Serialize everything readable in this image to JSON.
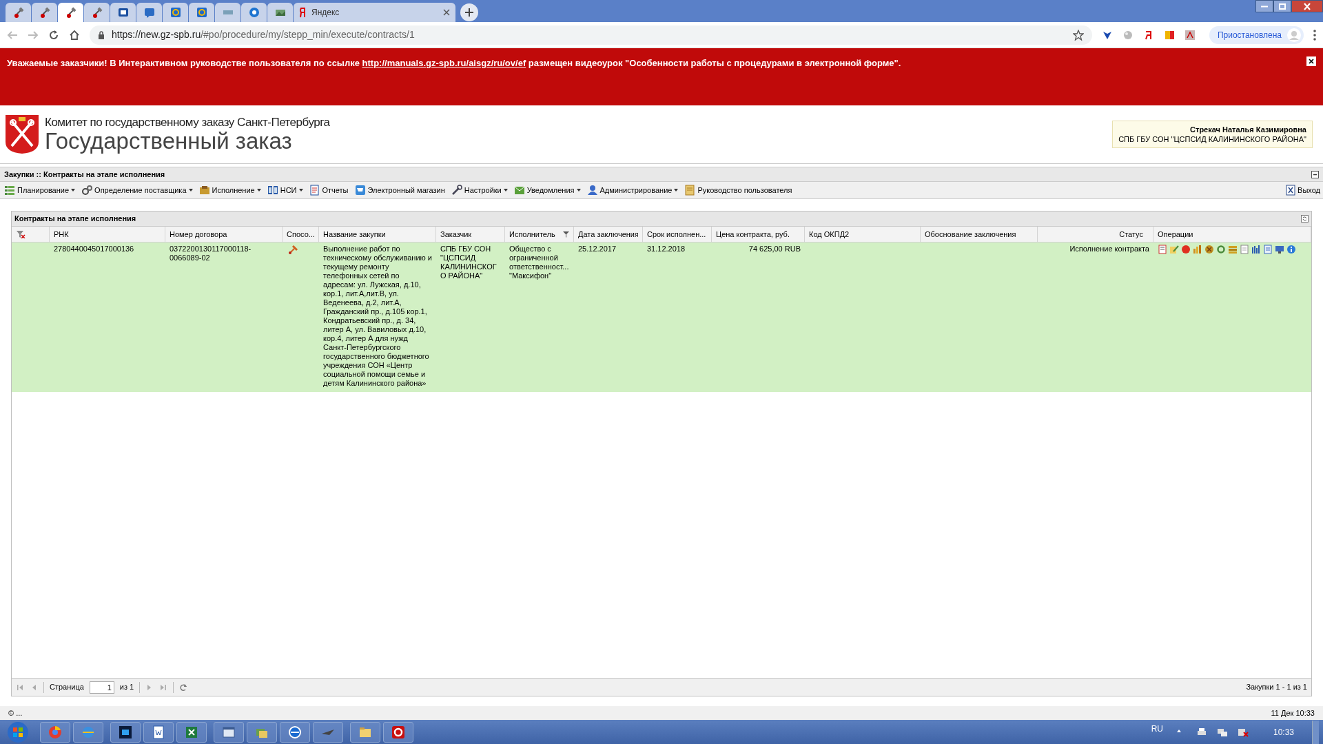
{
  "browser": {
    "tabs": [
      {
        "selected": false
      },
      {
        "selected": false
      },
      {
        "selected": true
      },
      {
        "selected": false
      },
      {
        "selected": false
      },
      {
        "selected": false
      },
      {
        "selected": false
      },
      {
        "selected": false
      },
      {
        "selected": false
      },
      {
        "selected": false
      },
      {
        "selected": false
      },
      {
        "selected": false,
        "label": "Яндекс"
      }
    ],
    "url_host": "https://new.gz-spb.ru",
    "url_path": "/#po/procedure/my/stepp_min/execute/contracts/1",
    "profile": "Приостановлена"
  },
  "banner": {
    "text_before": "Уважаемые заказчики! В Интерактивном руководстве пользователя по ссылке",
    "link": "http://manuals.gz-spb.ru/aisgz/ru/ov/ef",
    "text_after": "размещен видеоурок \"Особенности работы с процедурами в электронной форме\"."
  },
  "header": {
    "org": "Комитет по государственному заказу Санкт-Петербурга",
    "title": "Государственный заказ",
    "user_name": "Стрекач Наталья Казимировна",
    "user_org": "СПБ ГБУ СОН \"ЦСПСИД КАЛИНИНСКОГО РАЙОНА\""
  },
  "breadcrumb": "Закупки :: Контракты на этапе исполнения",
  "menu": [
    {
      "label": "Планирование",
      "dropdown": true
    },
    {
      "label": "Определение поставщика",
      "dropdown": true
    },
    {
      "label": "Исполнение",
      "dropdown": true
    },
    {
      "label": "НСИ",
      "dropdown": true
    },
    {
      "label": "Отчеты",
      "dropdown": false
    },
    {
      "label": "Электронный магазин",
      "dropdown": false
    },
    {
      "label": "Настройки",
      "dropdown": true
    },
    {
      "label": "Уведомления",
      "dropdown": true
    },
    {
      "label": "Администрирование",
      "dropdown": true
    },
    {
      "label": "Руководство пользователя",
      "dropdown": false
    }
  ],
  "exit": "Выход",
  "panel": {
    "title": "Контракты на этапе исполнения",
    "columns": [
      {
        "label": "РНК",
        "filtered": false
      },
      {
        "label": "Номер договора",
        "filtered": false
      },
      {
        "label": "Спосо...",
        "filtered": false
      },
      {
        "label": "Название закупки",
        "filtered": false
      },
      {
        "label": "Заказчик",
        "filtered": false
      },
      {
        "label": "Исполнитель",
        "filtered": true
      },
      {
        "label": "Дата заключения",
        "filtered": false
      },
      {
        "label": "Срок исполнен...",
        "filtered": false
      },
      {
        "label": "Цена контракта, руб.",
        "filtered": false
      },
      {
        "label": "Код ОКПД2",
        "filtered": false
      },
      {
        "label": "Обоснование заключения",
        "filtered": false
      },
      {
        "label": "Статус",
        "filtered": false
      },
      {
        "label": "Операции",
        "filtered": false
      }
    ],
    "rows": [
      {
        "selected": true,
        "rnk": "2780440045017000136",
        "contract_number": "0372200130117000118-0066089-02",
        "name": "Выполнение работ по техническому обслуживанию и текущему ремонту телефонных сетей по адресам: ул. Лужская, д.10, кор.1, лит.А,лит.В, ул. Веденеева, д.2, лит.А, Гражданский пр., д.105 кор.1, Кондратьевский пр., д. 34, литер А, ул. Вавиловых д.10, кор.4, литер А для нужд Санкт-Петербургского государственного бюджетного учреждения СОН «Центр социальной помощи семье и детям Калининского района»",
        "customer": "СПБ ГБУ СОН \"ЦСПСИД КАЛИНИНСКОГО РАЙОНА\"",
        "supplier": "Общество с ограниченной ответственност... \"Максифон\"",
        "date": "25.12.2017",
        "deadline": "31.12.2018",
        "price": "74 625,00 RUB",
        "status": "Исполнение контракта"
      }
    ],
    "pager": {
      "page_label": "Страница",
      "page": "1",
      "of": "из 1",
      "summary": "Закупки 1 - 1 из 1"
    }
  },
  "status_bar": {
    "left": "© ...",
    "right": "11 Дек 10:33"
  },
  "taskbar": {
    "language": "RU",
    "clock": "10:33"
  }
}
